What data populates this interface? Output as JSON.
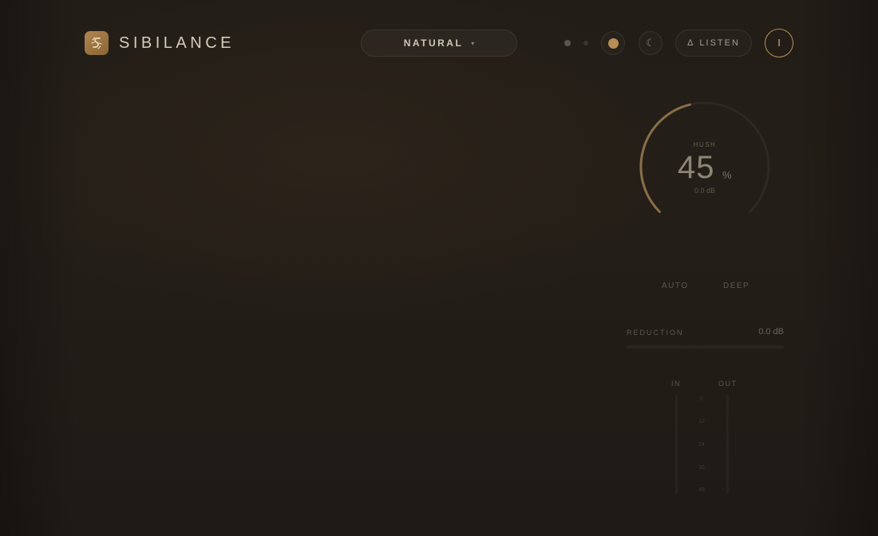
{
  "header": {
    "app_name": "SIBILANCE",
    "preset": {
      "label": "NATURAL",
      "caret": "▾"
    },
    "listen_label": "LISTEN",
    "listen_icon": "Δ",
    "moon_glyph": "☾",
    "power_glyph": "I"
  },
  "knob": {
    "label": "HUSH",
    "value": "45",
    "unit": "%",
    "sub": "0.0 dB",
    "fraction": 0.45
  },
  "modes": {
    "auto": "AUTO",
    "deep": "DEEP"
  },
  "reduction": {
    "label": "REDUCTION",
    "value": "0.0 dB",
    "fraction": 0
  },
  "meters": {
    "in_label": "IN",
    "out_label": "OUT",
    "scale": [
      "0",
      "12",
      "24",
      "36",
      "48"
    ]
  },
  "colors": {
    "accent": "#b68d55",
    "background": "#201c17",
    "text": "#d5ccbc"
  },
  "icons": {
    "logo": "sibilance-logo-icon",
    "preset_caret": "chevron-down-icon",
    "sun": "sun-icon",
    "moon": "moon-icon",
    "listen": "delta-icon",
    "power": "power-icon"
  }
}
